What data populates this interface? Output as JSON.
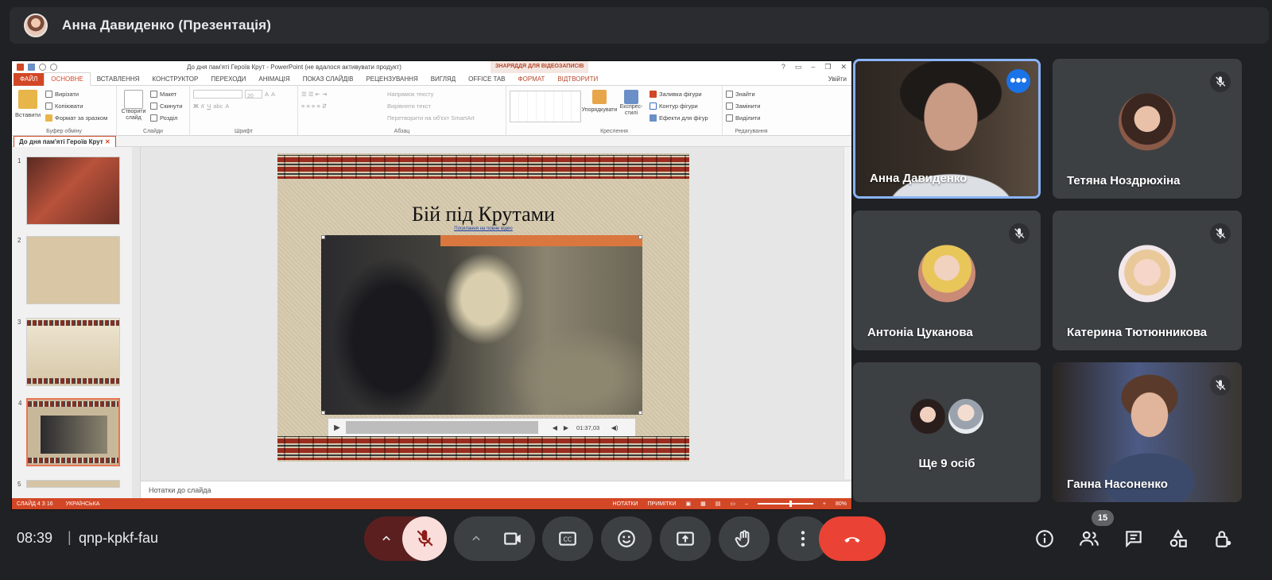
{
  "presenter_bar": {
    "title": "Анна Давиденко (Презентація)"
  },
  "powerpoint": {
    "window_title": "До дня пам'яті Героїв Крут - PowerPoint (не вдалося активувати продукт)",
    "tools_label": "ЗНАРЯДДЯ ДЛЯ ВІДЕОЗАПИСІВ",
    "tabs": [
      "ФАЙЛ",
      "ОСНОВНЕ",
      "ВСТАВЛЕННЯ",
      "КОНСТРУКТОР",
      "ПЕРЕХОДИ",
      "АНІМАЦІЯ",
      "ПОКАЗ СЛАЙДІВ",
      "РЕЦЕНЗУВАННЯ",
      "ВИГЛЯД",
      "OFFICE TAB",
      "ФОРМАТ",
      "ВІДТВОРИТИ"
    ],
    "signin": "Увійти",
    "ribbon": {
      "paste": "Вставити",
      "cut": "Вирізати",
      "copy": "Копіювати",
      "format_painter": "Формат за зразком",
      "clipboard_group": "Буфер обміну",
      "new_slide": "Створити слайд",
      "layout": "Макет",
      "reset": "Скинути",
      "section": "Розділ",
      "slides_group": "Слайди",
      "font_size": "20",
      "font_group": "Шрифт",
      "text_direction": "Напрямок тексту",
      "align_text": "Вирівняти текст",
      "smartart": "Перетворити на об'єкт SmartArt",
      "paragraph_group": "Абзац",
      "arrange": "Упорядкувати",
      "quick_styles": "Експрес-стилі",
      "shape_fill": "Заливка фігури",
      "shape_outline": "Контур фігури",
      "shape_effects": "Ефекти для фігур",
      "drawing_group": "Креслення",
      "find": "Знайти",
      "replace": "Замінити",
      "select": "Виділити",
      "editing_group": "Редагування"
    },
    "doc_tab": "До дня пам'яті Героїв Крут",
    "thumbnails": [
      {
        "num": "1"
      },
      {
        "num": "2"
      },
      {
        "num": "3"
      },
      {
        "num": "4"
      },
      {
        "num": "5"
      }
    ],
    "slide": {
      "title": "Бій під Крутами",
      "link": "Посилання на повне відео",
      "video_time": "01:37,03"
    },
    "notes_placeholder": "Нотатки до слайда",
    "status": {
      "slide": "СЛАЙД 4 З 16",
      "language": "УКРАЇНСЬКА",
      "notes": "НОТАТКИ",
      "comments": "ПРИМІТКИ",
      "zoom": "80%"
    }
  },
  "participants": [
    {
      "name": "Анна Давиденко",
      "speaking": true,
      "muted": false
    },
    {
      "name": "Тетяна Ноздрюхіна",
      "muted": true
    },
    {
      "name": "Антоніа Цуканова",
      "muted": true
    },
    {
      "name": "Катерина Тютюнникова",
      "muted": true
    },
    {
      "name": "Ще 9 осіб"
    },
    {
      "name": "Ганна Насоненко",
      "muted": true
    }
  ],
  "bottom_bar": {
    "time": "08:39",
    "separator": "|",
    "meeting_code": "qnp-kpkf-fau",
    "participant_count": "15"
  },
  "colors": {
    "background": "#202124",
    "tile": "#3c4043",
    "hangup": "#ea4335",
    "ppt_accent": "#d24726",
    "speaking_border": "#8ab4f8",
    "more_button": "#1a73e8"
  }
}
